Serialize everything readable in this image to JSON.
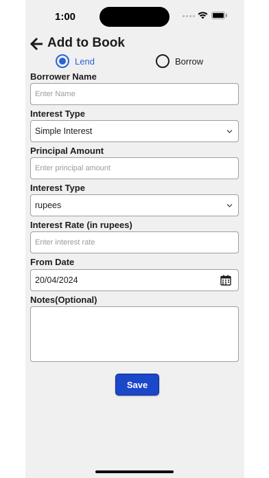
{
  "status_bar": {
    "time": "1:00"
  },
  "header": {
    "title": "Add to Book",
    "back_icon": "arrow-left-icon"
  },
  "transaction_type": {
    "options": [
      {
        "label": "Lend",
        "selected": true
      },
      {
        "label": "Borrow",
        "selected": false
      }
    ],
    "accent_color": "#2a63d3"
  },
  "form": {
    "borrower_name": {
      "label": "Borrower Name",
      "placeholder": "Enter Name",
      "value": ""
    },
    "interest_type": {
      "label": "Interest Type",
      "value": "Simple Interest"
    },
    "principal_amount": {
      "label": "Principal Amount",
      "placeholder": "Enter principal amount",
      "value": ""
    },
    "interest_unit": {
      "label": "Interest Type",
      "value": "rupees"
    },
    "interest_rate": {
      "label": "Interest Rate (in rupees)",
      "placeholder": "Enter interest rate",
      "value": ""
    },
    "from_date": {
      "label": "From Date",
      "value": "20/04/2024",
      "icon": "calendar-icon"
    },
    "notes": {
      "label": "Notes(Optional)",
      "value": ""
    }
  },
  "actions": {
    "save_label": "Save",
    "save_color": "#1b48c9"
  }
}
